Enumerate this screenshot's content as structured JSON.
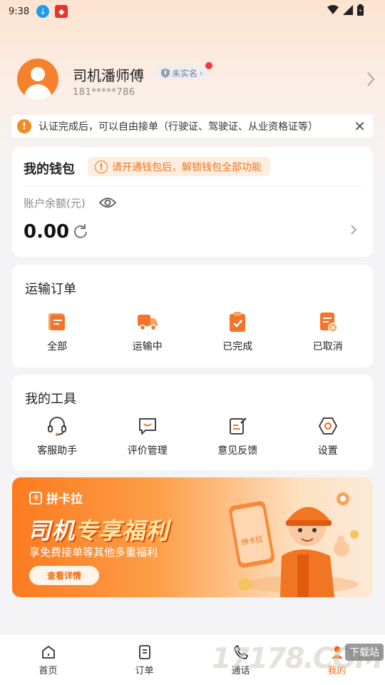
{
  "status_bar": {
    "time": "9:38"
  },
  "profile": {
    "name": "司机潘师傅",
    "verify_badge": "未实名",
    "phone": "181*****786"
  },
  "notice": {
    "text": "认证完成后，可以自由接单（行驶证、驾驶证、从业资格证等）"
  },
  "wallet": {
    "title": "我的钱包",
    "tip": "请开通钱包后，解锁钱包全部功能",
    "balance_label": "账户余额(元)",
    "balance": "0.00"
  },
  "orders": {
    "title": "运输订单",
    "items": [
      {
        "label": "全部",
        "icon": "list-icon"
      },
      {
        "label": "运输中",
        "icon": "truck-icon"
      },
      {
        "label": "已完成",
        "icon": "clipboard-check-icon"
      },
      {
        "label": "已取消",
        "icon": "doc-cancel-icon"
      }
    ]
  },
  "tools": {
    "title": "我的工具",
    "items": [
      {
        "label": "客服助手",
        "icon": "headset-icon"
      },
      {
        "label": "评价管理",
        "icon": "message-icon"
      },
      {
        "label": "意见反馈",
        "icon": "feedback-icon"
      },
      {
        "label": "设置",
        "icon": "settings-icon"
      }
    ]
  },
  "banner": {
    "brand": "拼卡拉",
    "headline_a": "司机",
    "headline_b": "专享福利",
    "subtitle": "享免费接单等其他多重福利",
    "cta": "查看详情",
    "phone_label": "拼卡拉"
  },
  "tabbar": {
    "items": [
      {
        "label": "首页",
        "icon": "home-icon"
      },
      {
        "label": "订单",
        "icon": "order-icon"
      },
      {
        "label": "通话",
        "icon": "phone-icon"
      },
      {
        "label": "我的",
        "icon": "user-icon"
      }
    ]
  },
  "watermark": {
    "text": "17178.COM",
    "tag": "下载站"
  },
  "colors": {
    "accent": "#f06a10",
    "avatar": "#f6812d",
    "badge_dot": "#f23a3a"
  }
}
